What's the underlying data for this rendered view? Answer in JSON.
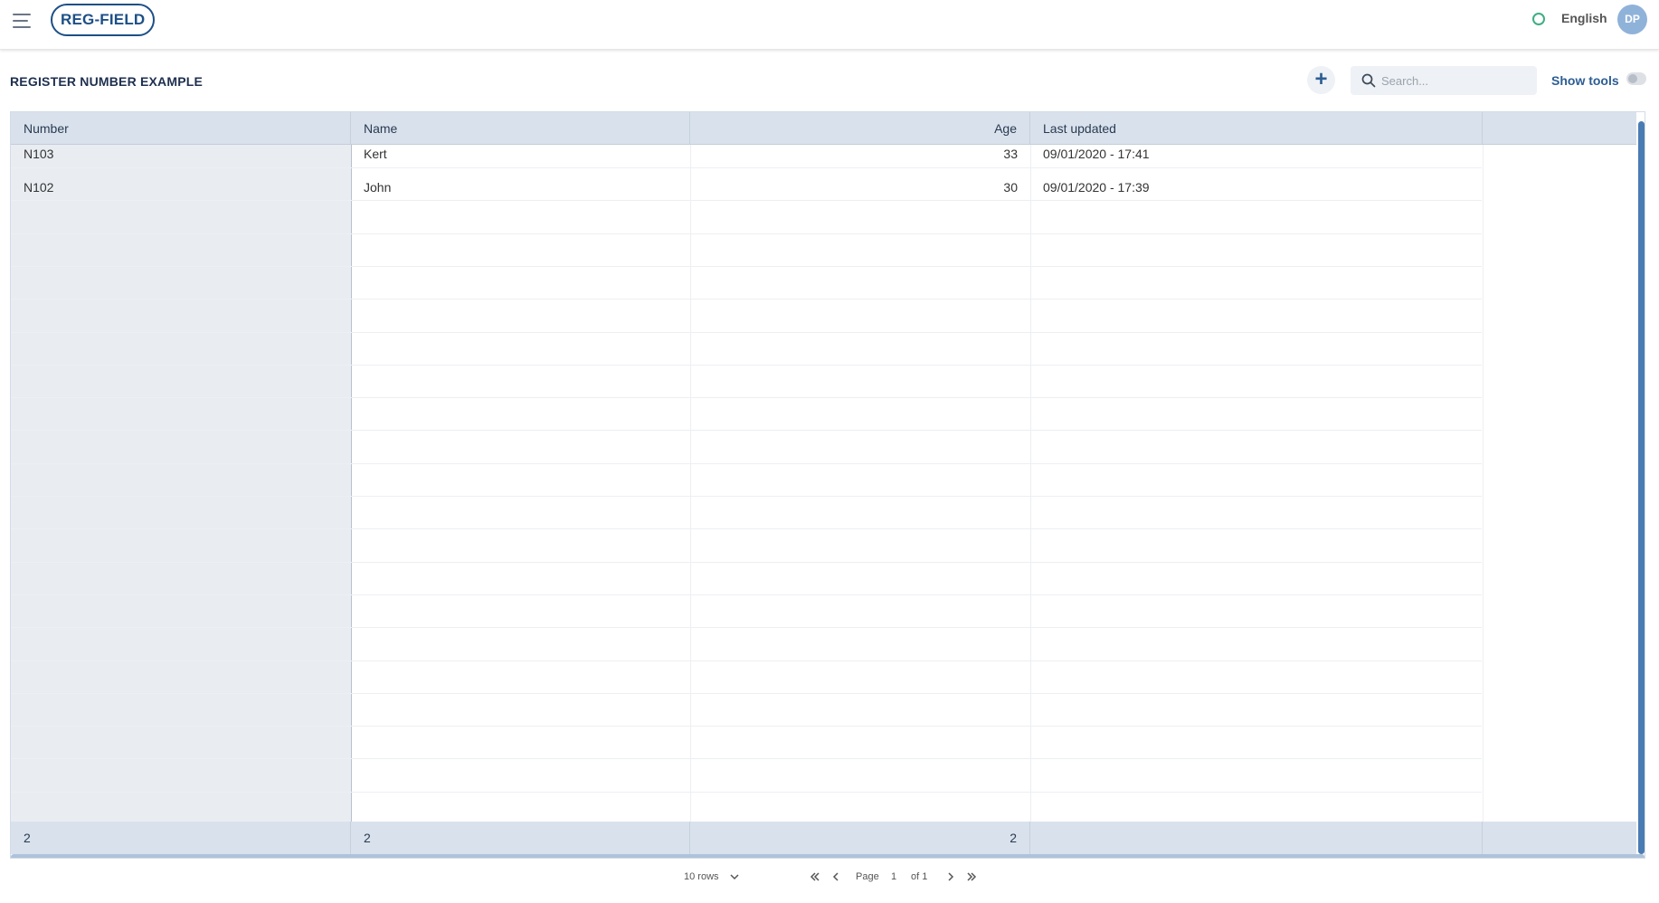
{
  "header": {
    "logo": "REG-FIELD",
    "language": "English",
    "user_initials": "DP"
  },
  "page": {
    "title": "REGISTER NUMBER EXAMPLE",
    "add_label": "+",
    "search_placeholder": "Search...",
    "show_tools_label": "Show tools",
    "show_tools_on": false
  },
  "grid": {
    "columns": [
      "Number",
      "Name",
      "Age",
      "Last updated"
    ],
    "rows": [
      {
        "number": "N103",
        "name": "Kert",
        "age": "33",
        "updated": "09/01/2020 - 17:41"
      },
      {
        "number": "N102",
        "name": "John",
        "age": "30",
        "updated": "09/01/2020 - 17:39"
      }
    ],
    "footer": {
      "number": "2",
      "name": "2",
      "age": "2"
    }
  },
  "pager": {
    "rows_label": "10 rows",
    "page_label": "Page",
    "current_page": "1",
    "of_label": "of 1"
  },
  "colors": {
    "brand": "#1d4f86",
    "header_bg": "#d9e2ec",
    "status": "#3eae84"
  }
}
